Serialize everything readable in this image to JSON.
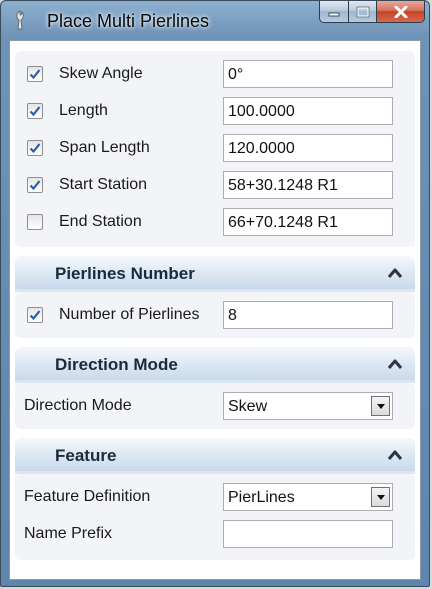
{
  "window": {
    "title": "Place Multi Pierlines",
    "buttons": {
      "minimize": "minimize-icon",
      "maximize": "maximize-icon",
      "close": "close-icon"
    }
  },
  "parameters": {
    "rows": [
      {
        "label": "Skew Angle",
        "checked": true,
        "value": "0°"
      },
      {
        "label": "Length",
        "checked": true,
        "value": "100.0000"
      },
      {
        "label": "Span Length",
        "checked": true,
        "value": "120.0000"
      },
      {
        "label": "Start Station",
        "checked": true,
        "value": "58+30.1248 R1"
      },
      {
        "label": "End Station",
        "checked": false,
        "value": "66+70.1248 R1"
      }
    ]
  },
  "pierlines_number": {
    "title": "Pierlines Number",
    "row": {
      "label": "Number of Pierlines",
      "checked": true,
      "value": "8"
    }
  },
  "direction_mode": {
    "title": "Direction Mode",
    "label": "Direction Mode",
    "selected": "Skew"
  },
  "feature": {
    "title": "Feature",
    "definition_label": "Feature Definition",
    "definition_selected": "PierLines",
    "name_prefix_label": "Name Prefix",
    "name_prefix_value": ""
  },
  "colors": {
    "title_bar": "#6f93b6",
    "section_header": "#dde8f3",
    "section_body": "#f2f4f7",
    "close_button": "#c4432a",
    "check_mark": "#2a5ea8"
  }
}
